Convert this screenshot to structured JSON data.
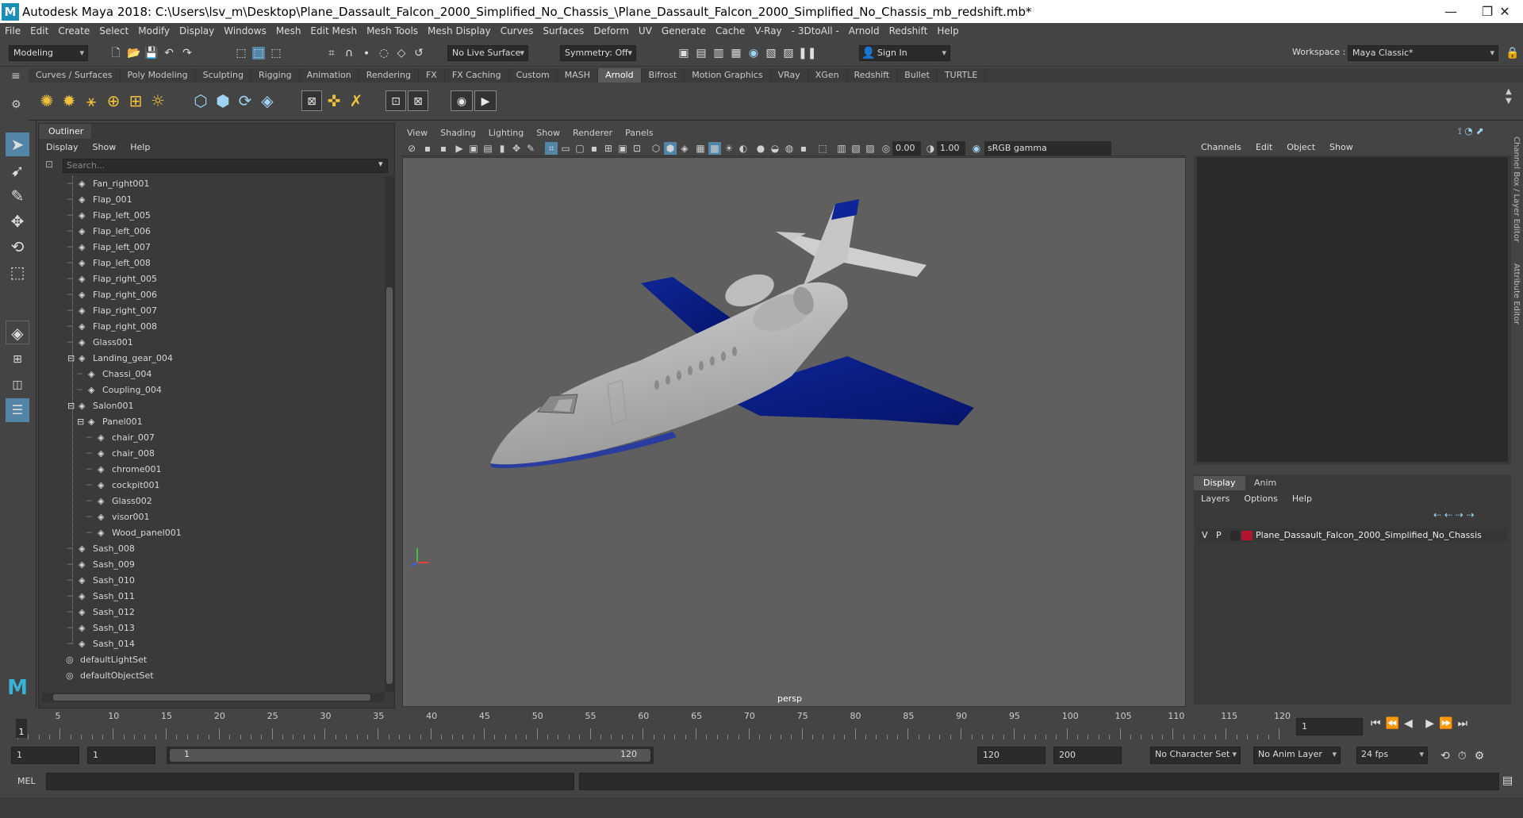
{
  "window": {
    "title": "Autodesk Maya 2018: C:\\Users\\lsv_m\\Desktop\\Plane_Dassault_Falcon_2000_Simplified_No_Chassis_\\Plane_Dassault_Falcon_2000_Simplified_No_Chassis_mb_redshift.mb*",
    "logo": "M",
    "minimize": "—",
    "restore": "❐",
    "close": "✕"
  },
  "menubar": [
    "File",
    "Edit",
    "Create",
    "Select",
    "Modify",
    "Display",
    "Windows",
    "Mesh",
    "Edit Mesh",
    "Mesh Tools",
    "Mesh Display",
    "Curves",
    "Surfaces",
    "Deform",
    "UV",
    "Generate",
    "Cache",
    "V-Ray",
    "- 3DtoAll -",
    "Arnold",
    "Redshift",
    "Help"
  ],
  "workspace": {
    "label": "Workspace :",
    "value": "Maya Classic*"
  },
  "statusline": {
    "mode": "Modeling",
    "live_surface": "No Live Surface",
    "symmetry": "Symmetry: Off",
    "sign_in": "Sign In"
  },
  "shelf_tabs": [
    "Curves / Surfaces",
    "Poly Modeling",
    "Sculpting",
    "Rigging",
    "Animation",
    "Rendering",
    "FX",
    "FX Caching",
    "Custom",
    "MASH",
    "Arnold",
    "Bifrost",
    "Motion Graphics",
    "VRay",
    "XGen",
    "Redshift",
    "Bullet",
    "TURTLE"
  ],
  "shelf_active": "Arnold",
  "outliner": {
    "tab": "Outliner",
    "menu": [
      "Display",
      "Show",
      "Help"
    ],
    "search_placeholder": "Search...",
    "items": [
      {
        "name": "Fan_right001",
        "level": 1
      },
      {
        "name": "Flap_001",
        "level": 1
      },
      {
        "name": "Flap_left_005",
        "level": 1
      },
      {
        "name": "Flap_left_006",
        "level": 1
      },
      {
        "name": "Flap_left_007",
        "level": 1
      },
      {
        "name": "Flap_left_008",
        "level": 1
      },
      {
        "name": "Flap_right_005",
        "level": 1
      },
      {
        "name": "Flap_right_006",
        "level": 1
      },
      {
        "name": "Flap_right_007",
        "level": 1
      },
      {
        "name": "Flap_right_008",
        "level": 1
      },
      {
        "name": "Glass001",
        "level": 1
      },
      {
        "name": "Landing_gear_004",
        "level": 1,
        "expanded": true
      },
      {
        "name": "Chassi_004",
        "level": 2
      },
      {
        "name": "Coupling_004",
        "level": 2
      },
      {
        "name": "Salon001",
        "level": 1,
        "expanded": true
      },
      {
        "name": "Panel001",
        "level": 2,
        "expanded": true
      },
      {
        "name": "chair_007",
        "level": 3
      },
      {
        "name": "chair_008",
        "level": 3
      },
      {
        "name": "chrome001",
        "level": 3
      },
      {
        "name": "cockpit001",
        "level": 3
      },
      {
        "name": "Glass002",
        "level": 3
      },
      {
        "name": "visor001",
        "level": 3
      },
      {
        "name": "Wood_panel001",
        "level": 3
      },
      {
        "name": "Sash_008",
        "level": 1
      },
      {
        "name": "Sash_009",
        "level": 1
      },
      {
        "name": "Sash_010",
        "level": 1
      },
      {
        "name": "Sash_011",
        "level": 1
      },
      {
        "name": "Sash_012",
        "level": 1
      },
      {
        "name": "Sash_013",
        "level": 1
      },
      {
        "name": "Sash_014",
        "level": 1
      },
      {
        "name": "defaultLightSet",
        "level": 0,
        "set": true
      },
      {
        "name": "defaultObjectSet",
        "level": 0,
        "set": true
      }
    ]
  },
  "viewport": {
    "menu": [
      "View",
      "Shading",
      "Lighting",
      "Show",
      "Renderer",
      "Panels"
    ],
    "near": "0.00",
    "far": "1.00",
    "color_space": "sRGB gamma",
    "camera": "persp"
  },
  "channel_box": {
    "menu": [
      "Channels",
      "Edit",
      "Object",
      "Show"
    ]
  },
  "layer_editor": {
    "tabs": [
      "Display",
      "Anim"
    ],
    "active_tab": "Display",
    "menu": [
      "Layers",
      "Options",
      "Help"
    ],
    "layer": {
      "v": "V",
      "p": "P",
      "name": "Plane_Dassault_Falcon_2000_Simplified_No_Chassis",
      "color": "#b31530"
    }
  },
  "side_tabs": [
    "Channel Box / Layer Editor",
    "Attribute Editor"
  ],
  "timeline": {
    "ticks": [
      "5",
      "10",
      "15",
      "20",
      "25",
      "30",
      "35",
      "40",
      "45",
      "50",
      "55",
      "60",
      "65",
      "70",
      "75",
      "80",
      "85",
      "90",
      "95",
      "100",
      "105",
      "110",
      "115",
      "120"
    ],
    "current_frame": "1",
    "current_field": "1"
  },
  "range": {
    "start": "1",
    "start2": "1",
    "slider_start": "1",
    "slider_end": "120",
    "end": "120",
    "end2": "200",
    "character_set": "No Character Set",
    "anim_layer": "No Anim Layer",
    "fps": "24 fps"
  },
  "command_line": {
    "label": "MEL"
  },
  "colors": {
    "accent": "#5285a6",
    "plane_body": "#b8b8b8",
    "plane_wing": "#0a1f8c"
  }
}
